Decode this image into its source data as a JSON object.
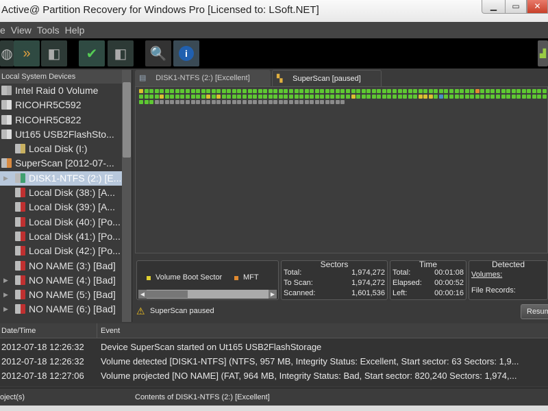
{
  "window": {
    "title": "Active@ Partition Recovery for Windows Pro [Licensed to: LSoft.NET]"
  },
  "menu": [
    "e",
    "View",
    "Tools",
    "Help"
  ],
  "toolbar": [
    "scan-disk-icon",
    "superscan-icon",
    "disk-icon",
    "recover-icon",
    "disk-save-icon",
    "search-icon",
    "info-icon"
  ],
  "left_panel": {
    "header": "Local System Devices",
    "items": [
      {
        "label": "Intel   Raid 0 Volume",
        "icon": "hdd",
        "indent": 0
      },
      {
        "label": "RICOHR5C592",
        "icon": "usb",
        "indent": 0
      },
      {
        "label": "RICOHR5C822",
        "icon": "usb",
        "indent": 0
      },
      {
        "label": "Ut165   USB2FlashSto...",
        "icon": "usb",
        "indent": 0
      },
      {
        "label": "Local Disk (I:)",
        "icon": "volume-warn",
        "indent": 1
      },
      {
        "label": "SuperScan [2012-07-...",
        "icon": "superscan",
        "indent": 0
      },
      {
        "label": "DISK1-NTFS (2:) [E...",
        "icon": "volume-good",
        "indent": 1,
        "selected": true,
        "arrow": true
      },
      {
        "label": "Local Disk (38:) [A...",
        "icon": "volume-bad",
        "indent": 1
      },
      {
        "label": "Local Disk (39:) [A...",
        "icon": "volume-bad",
        "indent": 1
      },
      {
        "label": "Local Disk (40:) [Po...",
        "icon": "volume-bad",
        "indent": 1
      },
      {
        "label": "Local Disk (41:) [Po...",
        "icon": "volume-bad",
        "indent": 1
      },
      {
        "label": "Local Disk (42:) [Po...",
        "icon": "volume-bad",
        "indent": 1
      },
      {
        "label": "NO NAME (3:) [Bad]",
        "icon": "volume-bad",
        "indent": 1
      },
      {
        "label": "NO NAME (4:) [Bad]",
        "icon": "volume-bad",
        "indent": 1,
        "arrow": true
      },
      {
        "label": "NO NAME (5:) [Bad]",
        "icon": "volume-bad",
        "indent": 1,
        "arrow": true
      },
      {
        "label": "NO NAME (6:) [Bad]",
        "icon": "volume-bad",
        "indent": 1,
        "arrow": true
      }
    ]
  },
  "tabs": [
    {
      "label": "DISK1-NTFS (2:) [Excellent]",
      "active": false
    },
    {
      "label": "SuperScan [paused]",
      "active": true
    }
  ],
  "scan_map": {
    "legend_colors": {
      "G": "#5ec832",
      "Y": "#d8c030",
      "M": "#e08a30",
      "B": "#4a90c8",
      "S": "#8a8a8a"
    },
    "rows": [
      "YGGGGGGGGGGGGGGGGGGGGGGGGGGGGGGGGGGGGGGGGGGGGGGGGGGGGGGGGGGGGGGGGMGGGGGGGGGGGGG",
      "GGGGYGGGGGGGGYGYGGGGGGGGGGGGGGGGGGGGGGGGGYGGGGGGGGGGGGYYYGBGGGGGGGGGGGGGGGGGGGG",
      "GGGSSSSSSSSSSSSSSSSSSSSSSSSSSSSSSSSSSSSS"
    ]
  },
  "legend": [
    {
      "label": "Volume Boot Sector",
      "color": "#e0d030"
    },
    {
      "label": "MFT",
      "color": "#e08a30"
    }
  ],
  "sectors": {
    "title": "Sectors",
    "total_label": "Total:",
    "total": "1,974,272",
    "toscan_label": "To Scan:",
    "toscan": "1,974,272",
    "scanned_label": "Scanned:",
    "scanned": "1,601,536"
  },
  "time": {
    "title": "Time",
    "total_label": "Total:",
    "total": "00:01:08",
    "elapsed_label": "Elapsed:",
    "elapsed": "00:00:52",
    "left_label": "Left:",
    "left": "00:00:16"
  },
  "detected": {
    "title": "Detected",
    "volumes_label": "Volumes:",
    "records_label": "File Records:"
  },
  "status": {
    "message": "SuperScan paused",
    "resume_label": "Resum"
  },
  "log": {
    "headers": [
      "Date/Time",
      "Event"
    ],
    "rows": [
      [
        "2012-07-18 12:26:32",
        "Device SuperScan started on Ut165   USB2FlashStorage"
      ],
      [
        "2012-07-18 12:26:32",
        "Volume detected [DISK1-NTFS] (NTFS, 957 MB, Integrity Status: Excellent, Start sector: 63 Sectors: 1,9..."
      ],
      [
        "2012-07-18 12:27:06",
        "Volume projected [NO NAME] (FAT, 964 MB, Integrity Status: Bad, Start sector: 820,240 Sectors: 1,974,..."
      ]
    ]
  },
  "statusbar": {
    "left": "oject(s)",
    "center": "Contents of DISK1-NTFS (2:) [Excellent]"
  }
}
